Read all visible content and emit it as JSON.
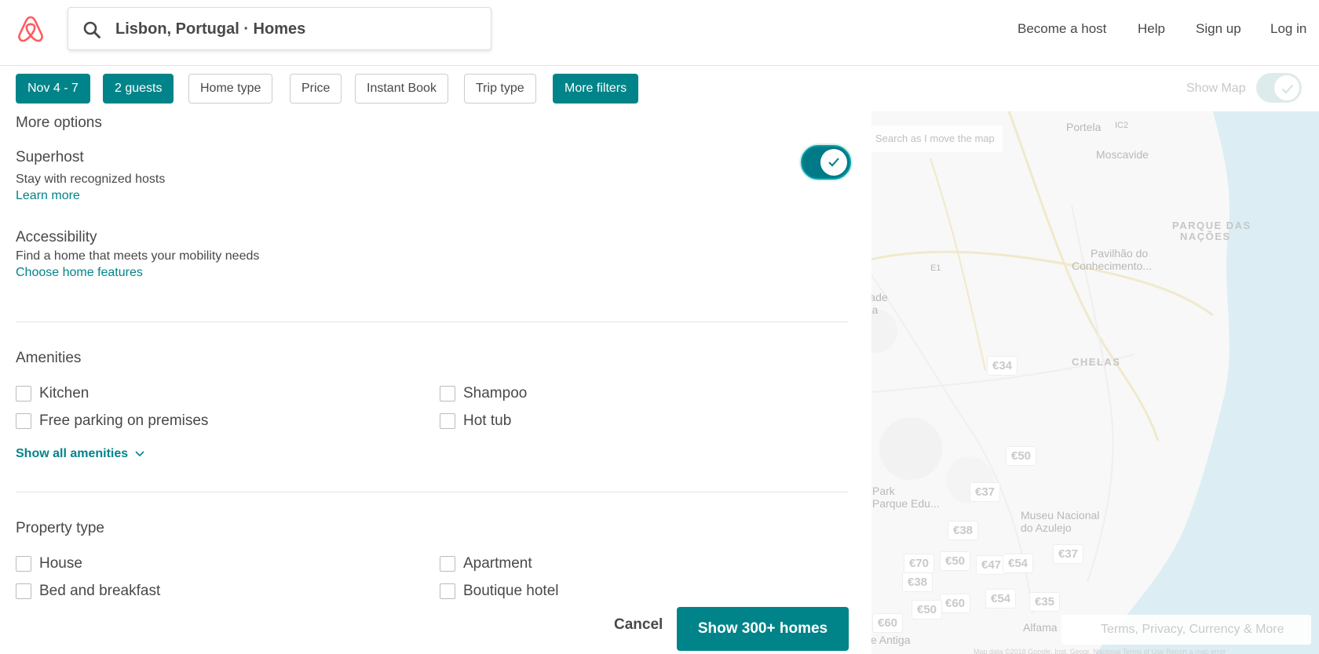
{
  "header": {
    "search_text": "Lisbon, Portugal · Homes",
    "nav": {
      "become_host": "Become a host",
      "help": "Help",
      "sign_up": "Sign up",
      "log_in": "Log in"
    }
  },
  "filters": {
    "dates": "Nov 4 - 7",
    "guests": "2 guests",
    "home_type": "Home type",
    "price": "Price",
    "instant_book": "Instant Book",
    "trip_type": "Trip type",
    "more_filters": "More filters",
    "show_map": "Show Map"
  },
  "panel": {
    "more_options": "More options",
    "superhost": {
      "title": "Superhost",
      "desc": "Stay with recognized hosts",
      "link": "Learn more",
      "enabled": true
    },
    "accessibility": {
      "title": "Accessibility",
      "desc": "Find a home that meets your mobility needs",
      "link": "Choose home features"
    },
    "amenities": {
      "title": "Amenities",
      "items": [
        "Kitchen",
        "Shampoo",
        "Free parking on premises",
        "Hot tub"
      ],
      "show_all": "Show all amenities"
    },
    "property_type": {
      "title": "Property type",
      "items": [
        "House",
        "Apartment",
        "Bed and breakfast",
        "Boutique hotel"
      ]
    }
  },
  "actions": {
    "cancel": "Cancel",
    "show_homes": "Show 300+ homes"
  },
  "map": {
    "search_as_move": "Search as I move the map",
    "labels": {
      "portela": "Portela",
      "moscavide": "Moscavide",
      "parque_das": "PARQUE DAS",
      "nacoes": "NAÇÕES",
      "pavilhao": "Pavilhão do",
      "conhecimento": "Conhecimento...",
      "chelas": "CHELAS",
      "park": "Park",
      "parque_edu": "Parque Edu...",
      "museu": "Museu Nacional",
      "azulejo": "do Azulejo",
      "alfama": "Alfama",
      "antiga": "te Antiga",
      "ersidade": "ersidade",
      "lisboa": "Lisboa",
      "road_e1": "E1",
      "road_ic2": "IC2"
    },
    "prices": {
      "p34": "€34",
      "p50a": "€50",
      "p37a": "€37",
      "p38a": "€38",
      "p37b": "€37",
      "p70": "€70",
      "p50b": "€50",
      "p47": "€47",
      "p54a": "€54",
      "p38b": "€38",
      "p60a": "€60",
      "p50c": "€50",
      "p54b": "€54",
      "p35": "€35",
      "p60b": "€60"
    },
    "footer": "Terms, Privacy, Currency & More",
    "copyright": "Map data ©2018 Google, Inst. Geogr. Nacional   Terms of Use   Report a map error"
  },
  "colors": {
    "accent": "#008489",
    "brand": "#FF5A5F",
    "text": "#484848"
  },
  "icons": {
    "logo": "airbnb-logo-icon",
    "search": "search-icon",
    "check": "check-icon",
    "chevron": "chevron-down-icon"
  }
}
